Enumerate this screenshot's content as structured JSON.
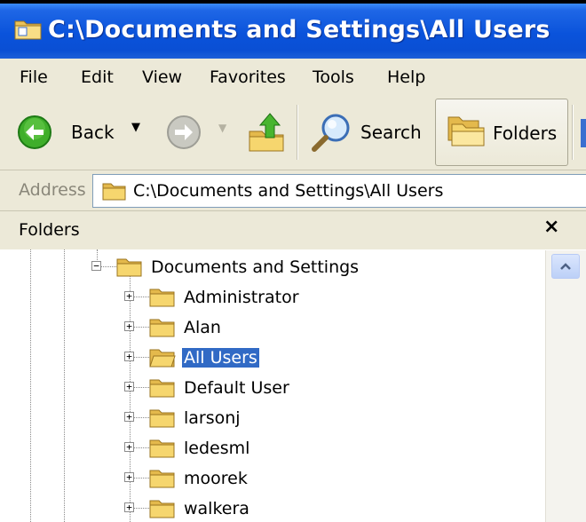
{
  "window": {
    "title": "C:\\Documents and Settings\\All Users"
  },
  "menu": [
    "File",
    "Edit",
    "View",
    "Favorites",
    "Tools",
    "Help"
  ],
  "toolbar": {
    "back_label": "Back",
    "search_label": "Search",
    "folders_label": "Folders"
  },
  "address": {
    "label": "Address",
    "value": "C:\\Documents and Settings\\All Users"
  },
  "folders_pane": {
    "title": "Folders",
    "close_glyph": "×"
  },
  "tree": {
    "root": {
      "label": "Documents and Settings",
      "expander": "−"
    },
    "children": [
      {
        "label": "Administrator",
        "expander": "+"
      },
      {
        "label": "Alan",
        "expander": "+"
      },
      {
        "label": "All Users",
        "expander": "+",
        "selected": true
      },
      {
        "label": "Default User",
        "expander": "+"
      },
      {
        "label": "larsonj",
        "expander": "+"
      },
      {
        "label": "ledesml",
        "expander": "+"
      },
      {
        "label": "moorek",
        "expander": "+"
      },
      {
        "label": "walkera",
        "expander": "+"
      }
    ]
  },
  "colors": {
    "title_blue": "#0a53db",
    "selection": "#316ac5",
    "chrome": "#ece9d8",
    "folder": "#f6d66e"
  }
}
